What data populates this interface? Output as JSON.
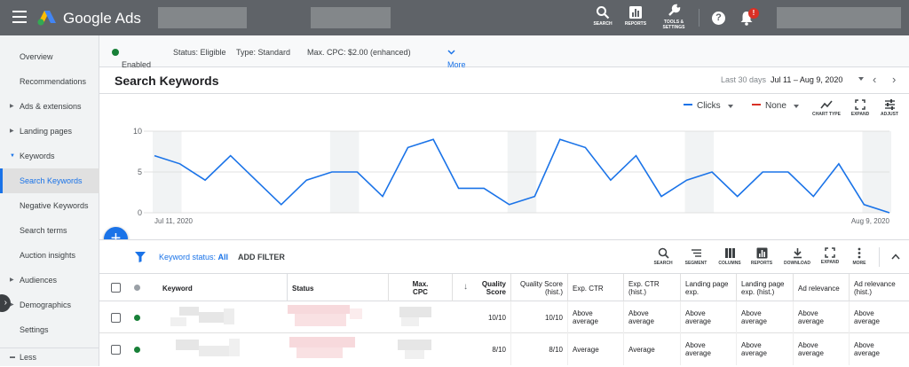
{
  "app": {
    "brand": "Google Ads"
  },
  "topbar": {
    "search": "SEARCH",
    "reports": "REPORTS",
    "tools_1": "TOOLS &",
    "tools_2": "SETTINGS",
    "help": "?",
    "notif_badge": "!"
  },
  "sidebar": {
    "items": [
      "Overview",
      "Recommendations",
      "Ads & extensions",
      "Landing pages",
      "Keywords",
      "Search Keywords",
      "Negative Keywords",
      "Search terms",
      "Auction insights",
      "Audiences",
      "Demographics",
      "Settings",
      "Less"
    ]
  },
  "status": {
    "enabled": "Enabled",
    "status": "Status: Eligible",
    "type": "Type: Standard",
    "cpc": "Max. CPC: $2.00 (enhanced)",
    "more": "More details"
  },
  "header": {
    "title": "Search Keywords",
    "range_label": "Last 30 days",
    "range": "Jul 11 – Aug 9, 2020"
  },
  "chart_controls": {
    "metric1": "Clicks",
    "metric2": "None",
    "chart_type": "CHART TYPE",
    "expand": "EXPAND",
    "adjust": "ADJUST"
  },
  "chart_data": {
    "type": "line",
    "x": [
      "Jul 11, 2020",
      "Jul 12",
      "Jul 13",
      "Jul 14",
      "Jul 15",
      "Jul 16",
      "Jul 17",
      "Jul 18",
      "Jul 19",
      "Jul 20",
      "Jul 21",
      "Jul 22",
      "Jul 23",
      "Jul 24",
      "Jul 25",
      "Jul 26",
      "Jul 27",
      "Jul 28",
      "Jul 29",
      "Jul 30",
      "Jul 31",
      "Aug 1",
      "Aug 2",
      "Aug 3",
      "Aug 4",
      "Aug 5",
      "Aug 6",
      "Aug 7",
      "Aug 8",
      "Aug 9, 2020"
    ],
    "series": [
      {
        "name": "Clicks",
        "values": [
          7,
          6,
          4,
          7,
          4,
          1,
          4,
          5,
          5,
          2,
          8,
          9,
          3,
          3,
          1,
          2,
          9,
          8,
          4,
          7,
          2,
          4,
          5,
          2,
          5,
          5,
          2,
          6,
          1,
          0
        ]
      }
    ],
    "ylim": [
      0,
      10
    ],
    "yticks": [
      "0",
      "5",
      "10"
    ],
    "xtick_first": "Jul 11, 2020",
    "xtick_last": "Aug 9, 2020",
    "weekend_bands": [
      [
        0,
        1
      ],
      [
        7,
        8
      ],
      [
        14,
        15
      ],
      [
        21,
        22
      ],
      [
        28,
        29
      ]
    ],
    "color": "#1a73e8"
  },
  "filterbar": {
    "status_label": "Keyword status:",
    "status_value": "All",
    "add_filter": "ADD FILTER",
    "tools": [
      "SEARCH",
      "SEGMENT",
      "COLUMNS",
      "REPORTS",
      "DOWNLOAD",
      "EXPAND",
      "MORE"
    ]
  },
  "table": {
    "headers": {
      "keyword": "Keyword",
      "status": "Status",
      "maxcpc_1": "Max.",
      "maxcpc_2": "CPC",
      "qs_1": "Quality",
      "qs_2": "Score",
      "qsh_1": "Quality Score",
      "qsh_2": "(hist.)",
      "ctr": "Exp. CTR",
      "ctrh_1": "Exp. CTR",
      "ctrh_2": "(hist.)",
      "lpe_1": "Landing page",
      "lpe_2": "exp.",
      "lpeh_1": "Landing page",
      "lpeh_2": "exp. (hist.)",
      "adrel": "Ad relevance",
      "adrelh_1": "Ad relevance",
      "adrelh_2": "(hist.)"
    },
    "rows": [
      {
        "qs": "10/10",
        "qsh": "10/10",
        "ctr_1": "Above",
        "ctr_2": "average",
        "ctrh_1": "Above",
        "ctrh_2": "average",
        "lpe_1": "Above",
        "lpe_2": "average",
        "lpeh_1": "Above",
        "lpeh_2": "average",
        "adrel_1": "Above",
        "adrel_2": "average",
        "adrelh_1": "Above",
        "adrelh_2": "average"
      },
      {
        "qs": "8/10",
        "qsh": "8/10",
        "ctr_1": "Average",
        "ctr_2": "",
        "ctrh_1": "Average",
        "ctrh_2": "",
        "lpe_1": "Above",
        "lpe_2": "average",
        "lpeh_1": "Above",
        "lpeh_2": "average",
        "adrel_1": "Above",
        "adrel_2": "average",
        "adrelh_1": "Above",
        "adrelh_2": "average"
      }
    ]
  }
}
